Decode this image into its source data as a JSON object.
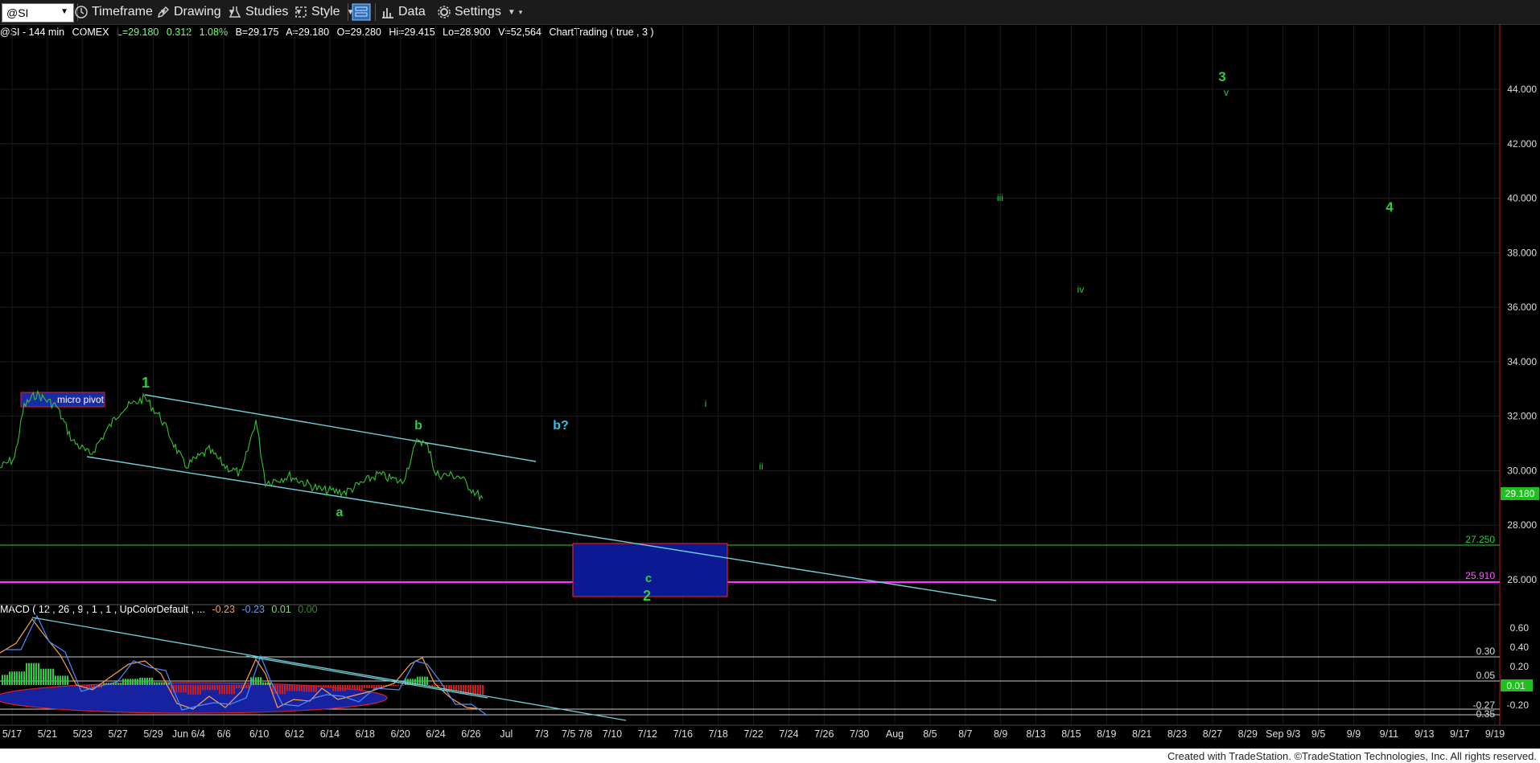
{
  "toolbar": {
    "symbol": "@SI",
    "timeframe": "Timeframe",
    "drawing": "Drawing",
    "studies": "Studies",
    "style": "Style",
    "data": "Data",
    "settings": "Settings"
  },
  "info": {
    "symbol": "@SI - 144 min",
    "exchange": "COMEX",
    "last": "L=29.180",
    "change": "0.312",
    "pct": "1.08%",
    "bid": "B=29.175",
    "ask": "A=29.180",
    "open": "O=29.280",
    "high": "Hi=29.415",
    "low": "Lo=28.900",
    "volume": "V=52,564",
    "chart_trading": "ChartTrading ( true , 3 )"
  },
  "macd_info": {
    "label": "MACD ( 12 , 26 , 9 , 1 , 1 , UpColorDefault , ...",
    "v1": "-0.23",
    "v2": "-0.23",
    "v3": "0.01",
    "v4": "0.00"
  },
  "price_axis": [
    "44.000",
    "42.000",
    "40.000",
    "38.000",
    "36.000",
    "34.000",
    "32.000",
    "30.000",
    "28.000",
    "26.000"
  ],
  "price_tags": {
    "last": "29.180",
    "h1": "27.250",
    "h2": "25.910"
  },
  "macd_axis": [
    "0.60",
    "0.40",
    "0.20",
    "-0.20"
  ],
  "macd_tags": {
    "a": "0.30",
    "b": "0.05",
    "c": "0.01",
    "d": "-0.27",
    "e": "-0.35"
  },
  "date_axis": [
    "5/17",
    "5/21",
    "5/23",
    "5/27",
    "5/29",
    "Jun 6/4",
    "6/6",
    "6/10",
    "6/12",
    "6/14",
    "6/18",
    "6/20",
    "6/24",
    "6/26",
    "Jul",
    "7/3",
    "7/5 7/8",
    "7/10",
    "7/12",
    "7/16",
    "7/18",
    "7/22",
    "7/24",
    "7/26",
    "7/30",
    "Aug",
    "8/5",
    "8/7",
    "8/9",
    "8/13",
    "8/15",
    "8/19",
    "8/21",
    "8/23",
    "8/27",
    "8/29",
    "Sep 9/3",
    "9/5",
    "9/9",
    "9/11",
    "9/13",
    "9/17",
    "9/19"
  ],
  "wave_labels": {
    "w1": "1",
    "b": "b",
    "a": "a",
    "bq": "b?",
    "c": "c",
    "w2": "2",
    "i": "i",
    "ii": "ii",
    "iii": "iii",
    "iv": "iv",
    "w3": "3",
    "v": "v",
    "w4": "4"
  },
  "micro_pivot": "micro pivot",
  "footer": "Created with TradeStation. ©TradeStation Technologies, Inc. All rights reserved.",
  "colors": {
    "green": "#2ecc40",
    "cyan": "#35c4e0",
    "trend": "#6fd0d8",
    "magenta": "#ff33ff",
    "hline": "#2e9e2e",
    "box": "#0a1b8f",
    "red": "#e02020"
  }
}
